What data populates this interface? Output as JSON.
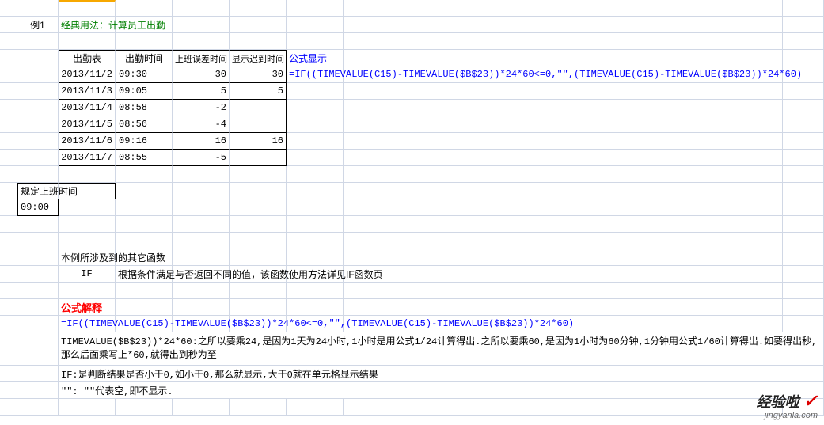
{
  "example_label": "例1",
  "classic_usage": "经典用法：计算员工出勤",
  "table": {
    "headers": [
      "出勤表",
      "出勤时间",
      "上班误差时间",
      "显示迟到时间"
    ],
    "formula_label": "公式显示",
    "rows": [
      {
        "date": "2013/11/2",
        "time": "09:30",
        "diff": "30",
        "late": "30"
      },
      {
        "date": "2013/11/3",
        "time": "09:05",
        "diff": "5",
        "late": "5"
      },
      {
        "date": "2013/11/4",
        "time": "08:58",
        "diff": "-2",
        "late": ""
      },
      {
        "date": "2013/11/5",
        "time": "08:56",
        "diff": "-4",
        "late": ""
      },
      {
        "date": "2013/11/6",
        "time": "09:16",
        "diff": "16",
        "late": "16"
      },
      {
        "date": "2013/11/7",
        "time": "08:55",
        "diff": "-5",
        "late": ""
      }
    ],
    "formula": "=IF((TIMEVALUE(C15)-TIMEVALUE($B$23))*24*60<=0,\"\",(TIMEVALUE(C15)-TIMEVALUE($B$23))*24*60)"
  },
  "work_time": {
    "label": "规定上班时间",
    "value": "09:00"
  },
  "other_funcs": {
    "header": "本例所涉及到的其它函数",
    "rows": [
      {
        "name": "IF",
        "desc": "根据条件满足与否返回不同的值，该函数使用方法详见IF函数页"
      }
    ]
  },
  "explanation": {
    "header": "公式解释",
    "formula": "=IF((TIMEVALUE(C15)-TIMEVALUE($B$23))*24*60<=0,\"\",(TIMEVALUE(C15)-TIMEVALUE($B$23))*24*60)",
    "line1": "TIMEVALUE($B$23))*24*60:之所以要乘24,是因为1天为24小时,1小时是用公式1/24计算得出.之所以要乘60,是因为1小时为60分钟,1分钟用公式1/60计算得出.如要得出秒,那么后面乘写上*60,就得出到秒为至",
    "line2": "IF:是判断结果是否小于0,如小于0,那么就显示,大于0就在单元格显示结果",
    "line3": "\"\": \"\"代表空,即不显示."
  },
  "watermark": {
    "brand": "经验啦",
    "check": "✓",
    "domain": "jingyanla.com"
  }
}
